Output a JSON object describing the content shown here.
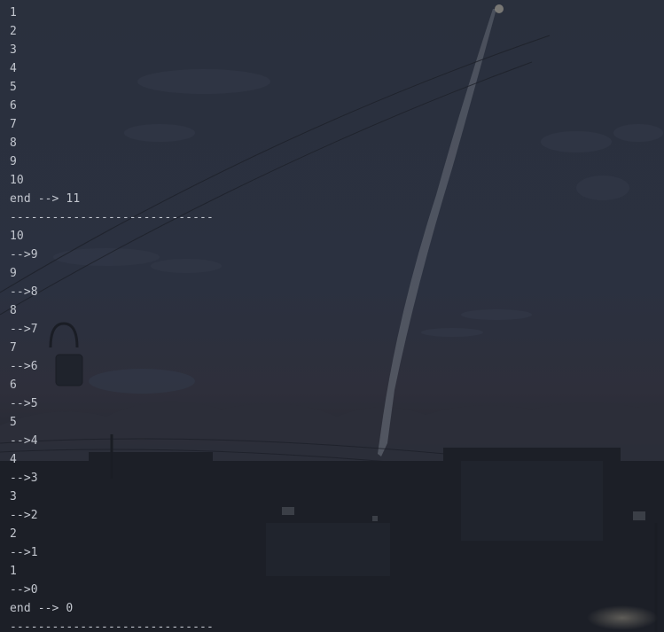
{
  "console": {
    "lines": [
      "1",
      "2",
      "3",
      "4",
      "5",
      "6",
      "7",
      "8",
      "9",
      "10",
      "end --> 11",
      "-----------------------------",
      "10",
      "-->9",
      "9",
      "-->8",
      "8",
      "-->7",
      "7",
      "-->6",
      "6",
      "-->5",
      "5",
      "-->4",
      "4",
      "-->3",
      "3",
      "-->2",
      "2",
      "-->1",
      "1",
      "-->0",
      "end --> 0",
      "-----------------------------"
    ]
  },
  "colors": {
    "text": "#c3c7cf",
    "sky": "#262b36",
    "ground": "#1b1e26"
  }
}
